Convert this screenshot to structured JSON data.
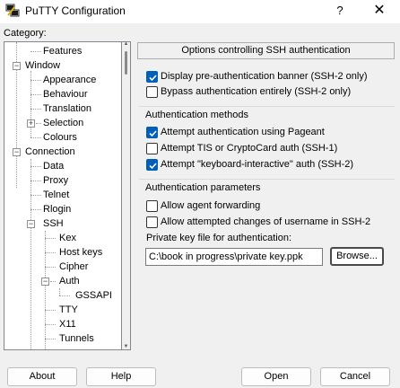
{
  "window": {
    "title": "PuTTY Configuration",
    "help_glyph": "?",
    "close_glyph": "✕"
  },
  "category_label": "Category:",
  "tree": {
    "features": "Features",
    "window": "Window",
    "appearance": "Appearance",
    "behaviour": "Behaviour",
    "translation": "Translation",
    "selection": "Selection",
    "colours": "Colours",
    "connection": "Connection",
    "data": "Data",
    "proxy": "Proxy",
    "telnet": "Telnet",
    "rlogin": "Rlogin",
    "ssh": "SSH",
    "kex": "Kex",
    "host_keys": "Host keys",
    "cipher": "Cipher",
    "auth": "Auth",
    "gssapi": "GSSAPI",
    "tty": "TTY",
    "x11": "X11",
    "tunnels": "Tunnels",
    "selected": "Auth"
  },
  "panel": {
    "header": "Options controlling SSH authentication",
    "banner": {
      "display_banner": {
        "label": "Display pre-authentication banner (SSH-2 only)",
        "checked": true
      },
      "bypass_auth": {
        "label": "Bypass authentication entirely (SSH-2 only)",
        "checked": false
      }
    },
    "methods": {
      "title": "Authentication methods",
      "pageant": {
        "label": "Attempt authentication using Pageant",
        "checked": true
      },
      "tis": {
        "label": "Attempt TIS or CryptoCard auth (SSH-1)",
        "checked": false
      },
      "keyboard_interactive": {
        "label": "Attempt \"keyboard-interactive\" auth (SSH-2)",
        "checked": true
      }
    },
    "params": {
      "title": "Authentication parameters",
      "agent_forwarding": {
        "label": "Allow agent forwarding",
        "checked": false
      },
      "username_changes": {
        "label": "Allow attempted changes of username in SSH-2",
        "checked": false
      },
      "key_file_label": "Private key file for authentication:",
      "key_file_value": "C:\\book in progress\\private key.ppk",
      "browse_label": "Browse..."
    }
  },
  "buttons": {
    "about": "About",
    "help": "Help",
    "open": "Open",
    "cancel": "Cancel"
  },
  "colors": {
    "checkbox_checked": "#005fb8",
    "window_bg": "#f0f0f0"
  }
}
